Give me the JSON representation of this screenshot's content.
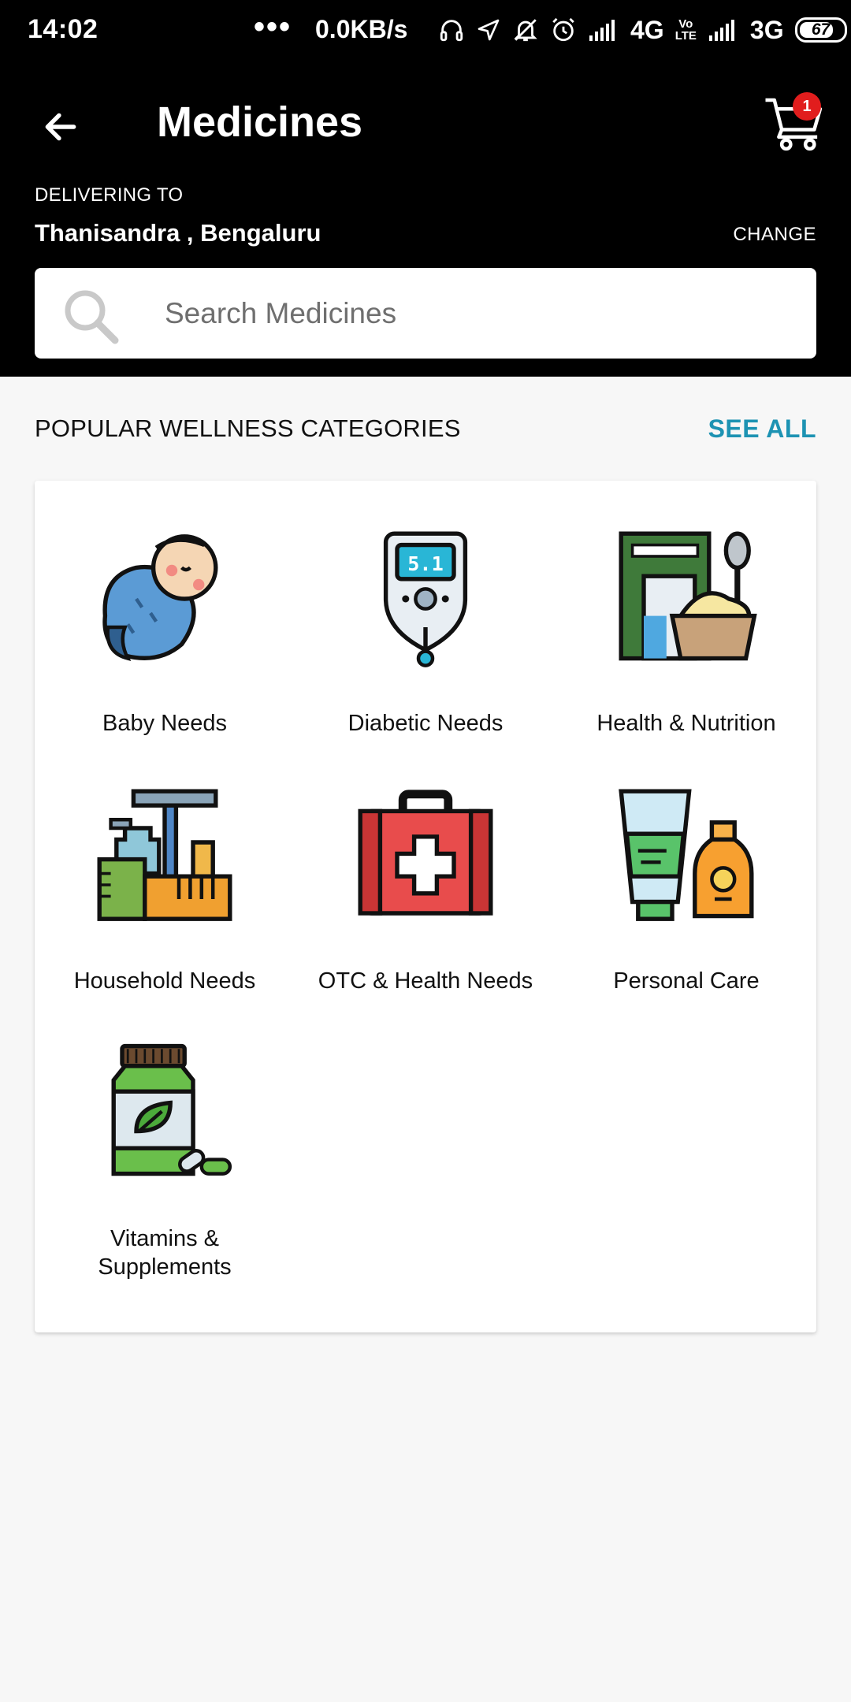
{
  "status_bar": {
    "time": "14:02",
    "dots": "•••",
    "speed": "0.0KB/s",
    "network1": "4G",
    "volte": "Vo\nLTE",
    "network2": "3G",
    "battery": "67"
  },
  "appbar": {
    "title": "Medicines",
    "cart_count": "1"
  },
  "delivery": {
    "label": "DELIVERING TO",
    "location": "Thanisandra , Bengaluru",
    "change_label": "CHANGE"
  },
  "search": {
    "placeholder": "Search Medicines"
  },
  "categories": {
    "title": "POPULAR WELLNESS CATEGORIES",
    "see_all": "SEE ALL",
    "items": [
      {
        "label": "Baby Needs",
        "icon": "baby-icon"
      },
      {
        "label": "Diabetic Needs",
        "icon": "glucometer-icon"
      },
      {
        "label": "Health & Nutrition",
        "icon": "nutrition-icon"
      },
      {
        "label": "Household Needs",
        "icon": "household-icon"
      },
      {
        "label": "OTC & Health Needs",
        "icon": "first-aid-kit-icon"
      },
      {
        "label": "Personal Care",
        "icon": "personal-care-icon"
      },
      {
        "label": "Vitamins &\nSupplements",
        "icon": "vitamins-icon"
      }
    ]
  },
  "colors": {
    "header_bg": "#000000",
    "accent": "#1d93b3",
    "badge": "#e11d1d",
    "page_bg": "#f7f7f7"
  }
}
